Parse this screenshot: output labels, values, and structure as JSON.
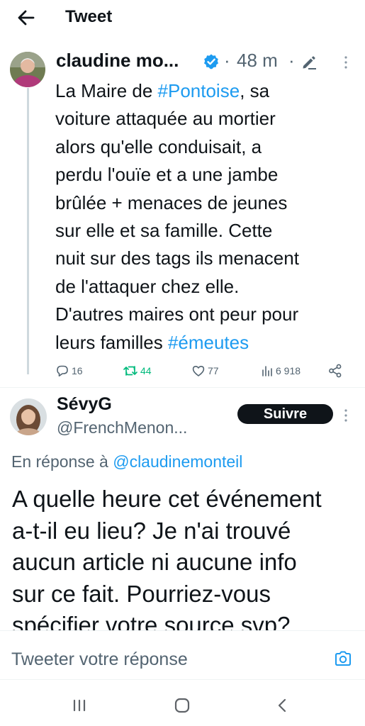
{
  "header": {
    "title": "Tweet"
  },
  "tweet1": {
    "author_name": "claudine mo...",
    "separator": "·",
    "time": "48 m",
    "lines": [
      [
        "La Maire de ",
        "#Pontoise",
        ", sa"
      ],
      "voiture attaquée au mortier",
      "alors qu'elle conduisait, a",
      "perdu l'ouïe et a une jambe",
      "brûlée + menaces de jeunes",
      "sur elle et sa famille.  Cette",
      "nuit sur des tags ils menacent",
      "de l'attaquer chez elle.",
      "D'autres maires ont peur pour",
      [
        "leurs familles ",
        "#émeutes"
      ]
    ],
    "stats": {
      "replies": "16",
      "retweets": "44",
      "likes": "77",
      "views": "6 918"
    }
  },
  "tweet2": {
    "author_name": "SévyG",
    "handle": "@FrenchMenon...",
    "follow_label": "Suivre",
    "reply_prefix": "En réponse à ",
    "reply_mention": "@claudinemonteil",
    "lines": [
      "A quelle heure cet événement",
      "a-t-il eu lieu? Je n'ai trouvé",
      "aucun article ni aucune info",
      "sur ce fait. Pourriez-vous",
      "spécifier votre source svp?"
    ]
  },
  "composer": {
    "placeholder": "Tweeter votre réponse"
  },
  "colors": {
    "accent": "#1d9bf0",
    "retweet": "#00ba7c",
    "secondary_text": "#536471",
    "follow_bg": "#0f1419"
  },
  "icons": [
    "back-arrow-icon",
    "verified-badge-icon",
    "edit-pencil-icon",
    "more-vertical-icon",
    "reply-icon",
    "retweet-icon",
    "like-icon",
    "views-icon",
    "share-icon",
    "camera-icon",
    "recents-icon",
    "home-icon",
    "nav-back-icon"
  ]
}
